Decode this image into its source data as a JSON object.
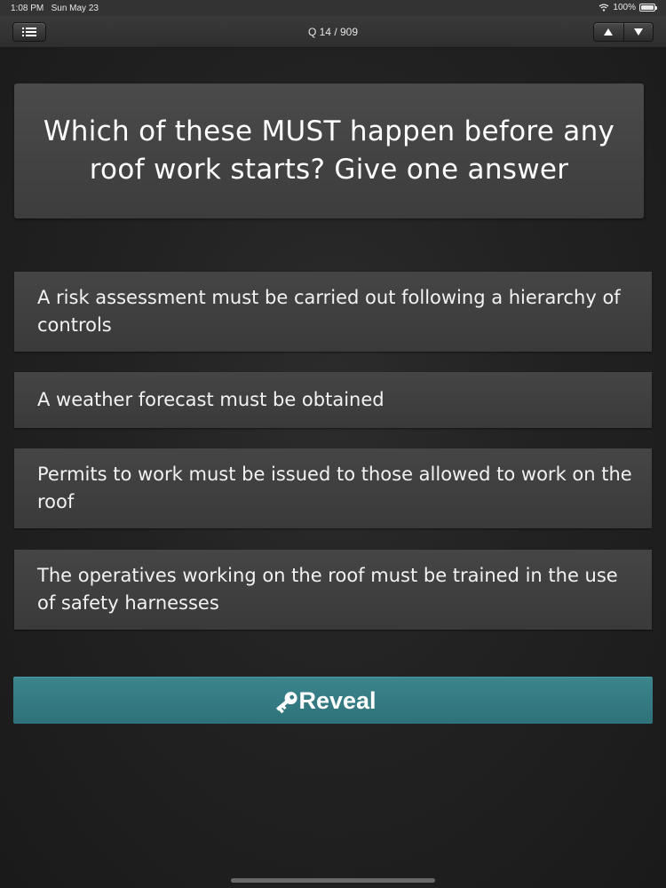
{
  "status_bar": {
    "time": "1:08 PM",
    "date": "Sun May 23",
    "battery": "100%",
    "icons": [
      "wifi-icon",
      "battery-icon"
    ]
  },
  "nav": {
    "title": "Q 14 / 909",
    "menu_icon": "list-icon",
    "prev_icon": "up-arrow-icon",
    "next_icon": "down-arrow-icon"
  },
  "question": {
    "text": "Which of these MUST happen before any roof work starts? Give one answer"
  },
  "answers": [
    {
      "text": "A risk assessment must be carried out following a hierarchy of controls"
    },
    {
      "text": "A weather forecast must be obtained"
    },
    {
      "text": "Permits to work must be issued to those allowed to work on the roof"
    },
    {
      "text": "The operatives working on the roof must be trained in the use of safety harnesses"
    }
  ],
  "reveal": {
    "label": "Reveal",
    "icon": "key-icon",
    "color": "#347a82"
  },
  "colors": {
    "background": "#222222",
    "card": "#444444",
    "accent": "#347a82"
  }
}
